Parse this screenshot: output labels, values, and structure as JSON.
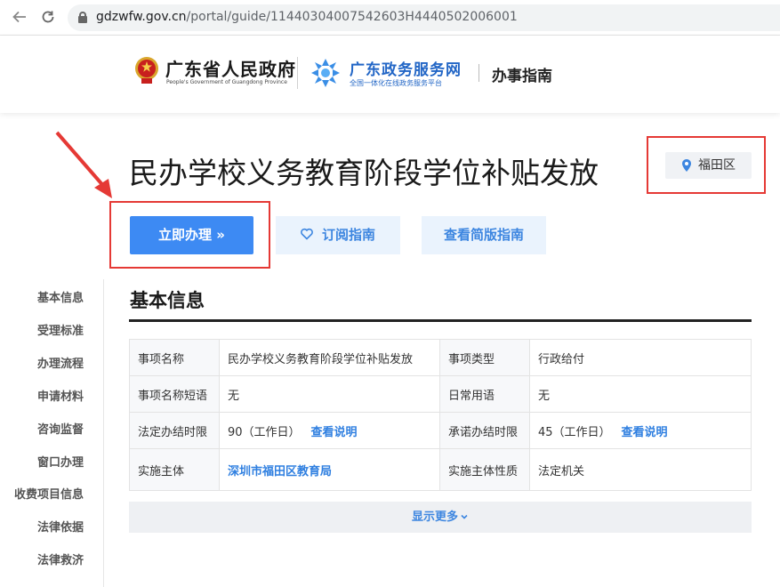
{
  "browser": {
    "back_icon": "arrow-left-icon",
    "reload_icon": "reload-icon",
    "url_domain": "gdzwfw.gov.cn",
    "url_path": "/portal/guide/11440304007542603H4440502006001"
  },
  "header": {
    "gov_name": "广东省人民政府",
    "gov_sub": "People's Government of Guangdong Province",
    "platform_name": "广东政务服务网",
    "platform_sub": "全国一体化在线政务服务平台",
    "section": "办事指南"
  },
  "page": {
    "title": "民办学校义务教育阶段学位补贴发放",
    "region": "福田区",
    "apply_label": "立即办理 »",
    "subscribe_label": "订阅指南",
    "simple_label": "查看简版指南"
  },
  "side_nav": {
    "items": [
      "基本信息",
      "受理标准",
      "办理流程",
      "申请材料",
      "咨询监督",
      "窗口办理",
      "收费项目信息",
      "法律依据",
      "法律救济"
    ]
  },
  "basic_info": {
    "title": "基本信息",
    "rows": [
      {
        "l1": "事项名称",
        "v1": "民办学校义务教育阶段学位补贴发放",
        "l2": "事项类型",
        "v2": "行政给付"
      },
      {
        "l1": "事项名称短语",
        "v1": "无",
        "l2": "日常用语",
        "v2": "无"
      },
      {
        "l1": "法定办结时限",
        "v1": "90（工作日）",
        "v1_link": "查看说明",
        "l2": "承诺办结时限",
        "v2": "45（工作日）",
        "v2_link": "查看说明"
      },
      {
        "l1": "实施主体",
        "v1": "深圳市福田区教育局",
        "l2": "实施主体性质",
        "v2": "法定机关"
      }
    ],
    "show_more": "显示更多"
  },
  "colors": {
    "primary": "#3d8af3",
    "annotation_red": "#e53935",
    "link": "#2f7fe0"
  }
}
